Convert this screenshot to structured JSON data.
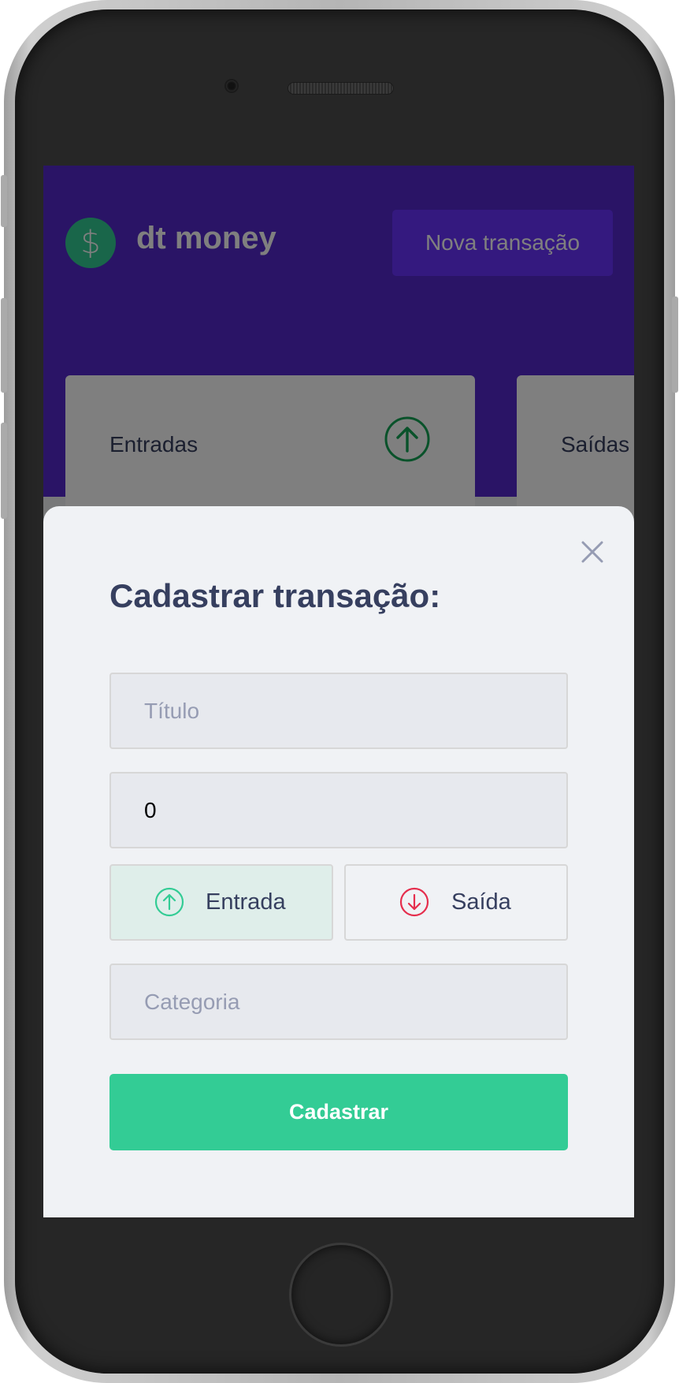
{
  "app": {
    "logo_symbol": "$",
    "title": "dt money",
    "new_transaction_label": "Nova transação"
  },
  "summary": {
    "cards": [
      {
        "label": "Entradas",
        "icon": "arrow-up-circle-icon"
      },
      {
        "label": "Saídas",
        "icon": "arrow-down-circle-icon"
      }
    ]
  },
  "modal": {
    "title": "Cadastrar transação:",
    "title_placeholder": "Título",
    "amount_value": "0",
    "type_options": [
      {
        "label": "Entrada",
        "icon": "arrow-up-circle-icon",
        "selected": true
      },
      {
        "label": "Saída",
        "icon": "arrow-down-circle-icon",
        "selected": false
      }
    ],
    "category_placeholder": "Categoria",
    "submit_label": "Cadastrar",
    "close_icon": "close-icon"
  },
  "colors": {
    "header": "#5429cc",
    "accent_button": "#6933ff",
    "green": "#33cc95",
    "red": "#e52e4d",
    "text_title": "#363f5f",
    "placeholder": "#969cb3",
    "modal_bg": "#f0f2f5"
  }
}
